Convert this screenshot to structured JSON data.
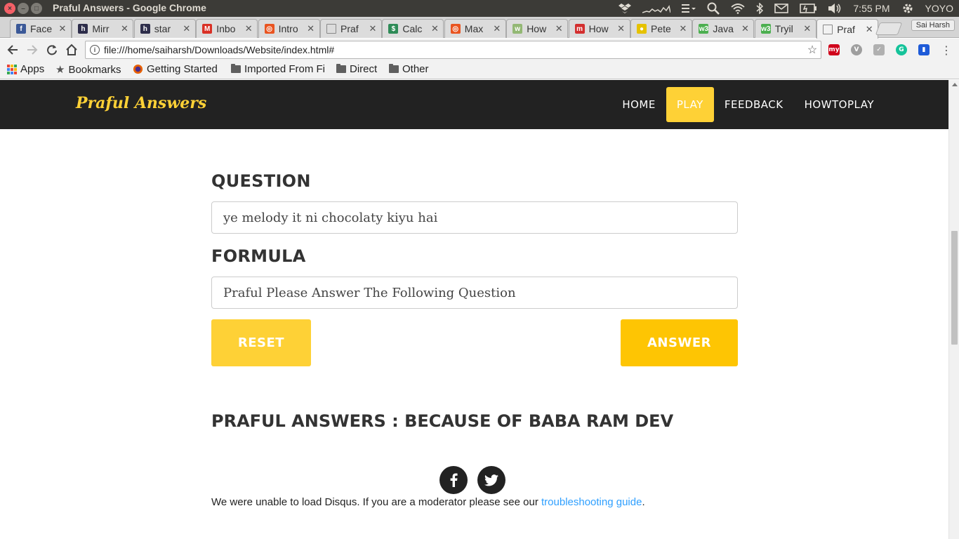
{
  "os": {
    "window_title": "Praful Answers - Google Chrome",
    "clock": "7:55 PM",
    "user": "YOYO"
  },
  "tabs": [
    {
      "label": "Face",
      "icon": "facebook-icon",
      "color": "#3b5998"
    },
    {
      "label": "Mirr",
      "icon": "h-icon",
      "color": "#2d2d4a"
    },
    {
      "label": "star",
      "icon": "h-icon",
      "color": "#2d2d4a"
    },
    {
      "label": "Inbo",
      "icon": "gmail-icon",
      "color": "#d93025"
    },
    {
      "label": "Intro",
      "icon": "ubuntu-icon",
      "color": "#e95420"
    },
    {
      "label": "Praf",
      "icon": "page-icon",
      "color": "#888888"
    },
    {
      "label": "Calc",
      "icon": "dollar-icon",
      "color": "#2e8b57"
    },
    {
      "label": "Max",
      "icon": "ubuntu-icon",
      "color": "#e95420"
    },
    {
      "label": "How",
      "icon": "wikihow-icon",
      "color": "#93b874"
    },
    {
      "label": "How",
      "icon": "m-icon",
      "color": "#d32f2f"
    },
    {
      "label": "Pete",
      "icon": "pete-icon",
      "color": "#e6c200"
    },
    {
      "label": "Java",
      "icon": "w3-icon",
      "color": "#4caf50"
    },
    {
      "label": "Tryil",
      "icon": "w3-icon",
      "color": "#4caf50"
    },
    {
      "label": "Praf",
      "icon": "page-icon",
      "color": "#888888",
      "active": true
    }
  ],
  "profile_name": "Sai Harsh",
  "address": {
    "url": "file:///home/saiharsh/Downloads/Website/index.html#"
  },
  "bookmarks": [
    {
      "label": "Apps",
      "icon": "apps-grid-icon"
    },
    {
      "label": "Bookmarks",
      "icon": "star-icon"
    },
    {
      "label": "Getting Started",
      "icon": "firefox-icon"
    },
    {
      "label": "Imported From Fi",
      "icon": "folder-icon"
    },
    {
      "label": "Direct",
      "icon": "folder-icon"
    },
    {
      "label": "Other",
      "icon": "folder-icon"
    }
  ],
  "site": {
    "brand": "Praful Answers",
    "nav": [
      {
        "label": "HOME",
        "active": false
      },
      {
        "label": "PLAY",
        "active": true
      },
      {
        "label": "FEEDBACK",
        "active": false
      },
      {
        "label": "HOWTOPLAY",
        "active": false
      }
    ],
    "question_label": "QUESTION",
    "question_value": "ye melody it ni chocolaty kiyu hai",
    "formula_label": "FORMULA",
    "formula_value": "Praful Please Answer The Following Question",
    "reset_label": "RESET",
    "answer_label": "ANSWER",
    "tagline": "PRAFUL ANSWERS : BECAUSE OF BABA RAM DEV",
    "social": [
      "f",
      "t"
    ],
    "disqus_text": "We were unable to load Disqus. If you are a moderator please see our ",
    "disqus_link": "troubleshooting guide",
    "disqus_end": "."
  },
  "colors": {
    "accent": "#fed136",
    "accent_dark": "#fec503",
    "nav_bg": "#222222",
    "link": "#2e9fff"
  }
}
